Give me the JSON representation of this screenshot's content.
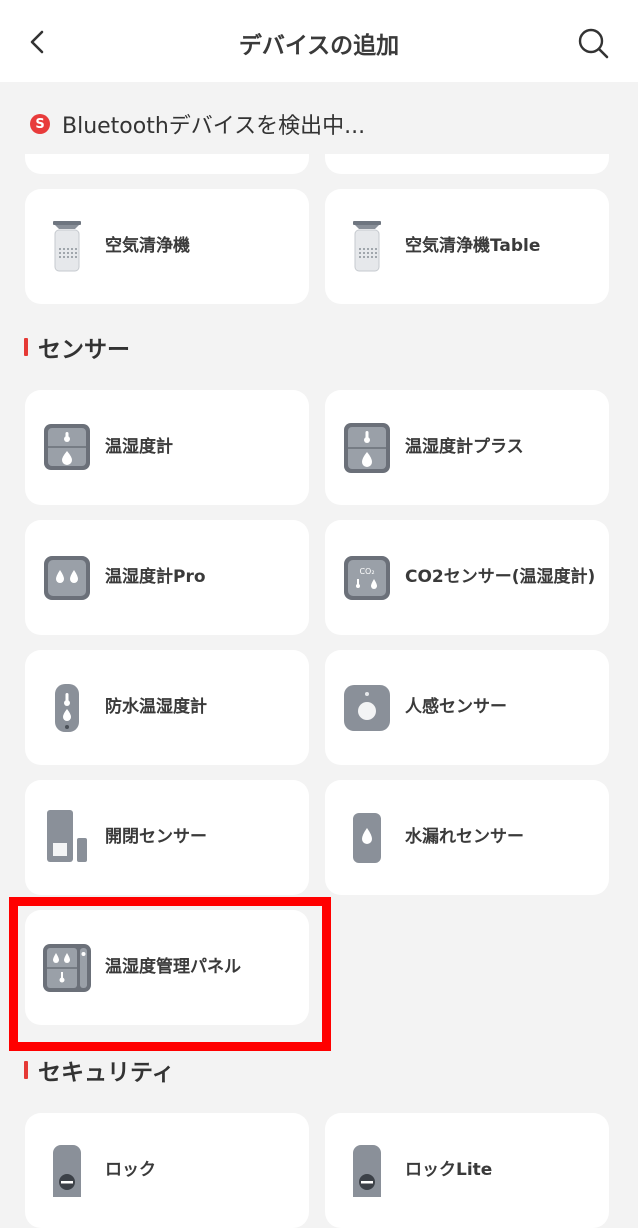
{
  "header": {
    "title": "デバイスの追加"
  },
  "scan": {
    "badge": "S",
    "text": "Bluetoothデバイスを検出中..."
  },
  "air": [
    {
      "label": "空気清浄機"
    },
    {
      "label": "空気清浄機Table"
    }
  ],
  "sections": {
    "sensor": "センサー",
    "security": "セキュリティ"
  },
  "sensors": [
    {
      "label": "温湿度計"
    },
    {
      "label": "温湿度計プラス"
    },
    {
      "label": "温湿度計Pro"
    },
    {
      "label": "CO2センサー(温湿度計)"
    },
    {
      "label": "防水温湿度計"
    },
    {
      "label": "人感センサー"
    },
    {
      "label": "開閉センサー"
    },
    {
      "label": "水漏れセンサー"
    },
    {
      "label": "温湿度管理パネル"
    }
  ],
  "security": [
    {
      "label": "ロック"
    },
    {
      "label": "ロックLite"
    }
  ],
  "colors": {
    "accent": "#e53935",
    "highlight": "#ff0000",
    "icon_gray": "#8a9099"
  }
}
